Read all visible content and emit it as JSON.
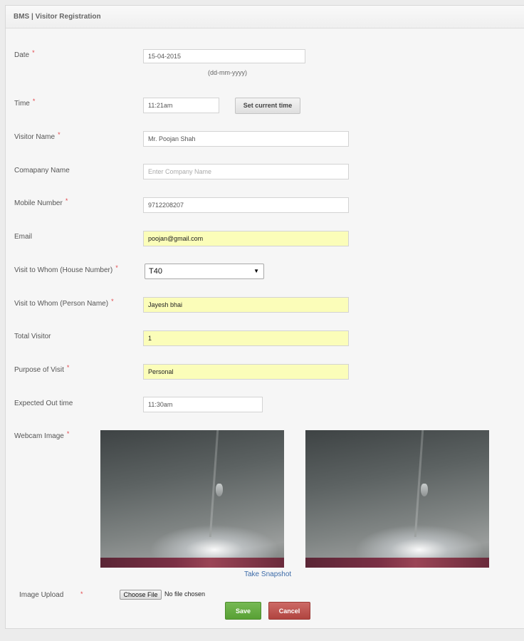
{
  "header": {
    "title": "BMS | Visitor Registration"
  },
  "required_mark": "*",
  "form": {
    "date": {
      "label": "Date",
      "value": "15-04-2015",
      "hint": "(dd-mm-yyyy)"
    },
    "time": {
      "label": "Time",
      "value": "11:21am",
      "button": "Set current time"
    },
    "visitor_name": {
      "label": "Visitor Name",
      "value": "Mr. Poojan Shah"
    },
    "company_name": {
      "label": "Comapany Name",
      "value": "",
      "placeholder": "Enter Company Name"
    },
    "mobile": {
      "label": "Mobile Number",
      "value": "9712208207"
    },
    "email": {
      "label": "Email",
      "value": "poojan@gmail.com"
    },
    "house_number": {
      "label": "Visit to Whom (House Number)",
      "selected": "T40"
    },
    "person_name": {
      "label": "Visit to Whom (Person Name)",
      "value": "Jayesh bhai"
    },
    "total_visitor": {
      "label": "Total Visitor",
      "value": "1"
    },
    "purpose": {
      "label": "Purpose of Visit",
      "value": "Personal"
    },
    "expected_out": {
      "label": "Expected Out time",
      "value": "11:30am"
    },
    "webcam": {
      "label": "Webcam Image",
      "snapshot_link": "Take Snapshot"
    },
    "image_upload": {
      "label": "Image Upload",
      "button": "Choose File",
      "status": "No file chosen"
    }
  },
  "actions": {
    "save": "Save",
    "cancel": "Cancel"
  },
  "colors": {
    "required": "#e2464b",
    "autofill_yellow": "#fbfdb9",
    "save_green": "#5ca53a",
    "cancel_red": "#b8504b",
    "link_blue": "#3b6aa8"
  }
}
